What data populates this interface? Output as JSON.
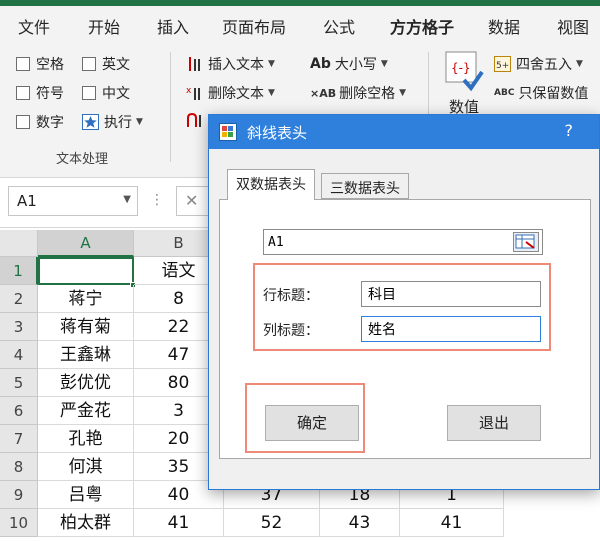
{
  "ribbon_tabs": [
    "文件",
    "开始",
    "插入",
    "页面布局",
    "公式",
    "方方格子",
    "数据",
    "视图"
  ],
  "ribbon": {
    "checkboxes": [
      "空格",
      "英文",
      "符号",
      "中文",
      "数字"
    ],
    "execute_label": "执行",
    "text_ops": [
      "插入文本",
      "删除文本"
    ],
    "case_label": "大小写",
    "case_icon_text": "Ab",
    "remove_space_label": "删除空格",
    "remove_space_icon_text": "×AB",
    "group_label": "文本处理",
    "value_label": "数值",
    "round_label": "四舍五入",
    "keep_value_label": "只保留数值",
    "keep_value_icon_text": "ABC"
  },
  "formula_bar": {
    "name_box": "A1",
    "dots": "⋮",
    "cancel": "✕"
  },
  "sheet": {
    "columns": [
      "A",
      "B"
    ],
    "selected_column": "A",
    "rows": [
      {
        "row": "1",
        "a": "",
        "b": "语文"
      },
      {
        "row": "2",
        "a": "蒋宁",
        "b": "8"
      },
      {
        "row": "3",
        "a": "蒋有菊",
        "b": "22"
      },
      {
        "row": "4",
        "a": "王鑫琳",
        "b": "47"
      },
      {
        "row": "5",
        "a": "彭优优",
        "b": "80"
      },
      {
        "row": "6",
        "a": "严金花",
        "b": "3"
      },
      {
        "row": "7",
        "a": "孔艳",
        "b": "20"
      },
      {
        "row": "8",
        "a": "何淇",
        "b": "35"
      },
      {
        "row": "9",
        "a": "吕粤",
        "b": "40"
      },
      {
        "row": "10",
        "a": "柏太群",
        "b": "41"
      }
    ],
    "visible_right_row9": [
      "37",
      "18",
      "1"
    ],
    "visible_right_row10": [
      "52",
      "43",
      "41"
    ]
  },
  "dialog": {
    "title": "斜线表头",
    "help": "?",
    "tabs": [
      "双数据表头",
      "三数据表头"
    ],
    "active_tab": 0,
    "reference": "A1",
    "row_title_label": "行标题：",
    "row_title_value": "科目",
    "col_title_label": "列标题：",
    "col_title_value": "姓名",
    "ok_label": "确定",
    "exit_label": "退出"
  },
  "colors": {
    "accent": "#217346",
    "dialog_title": "#2f80dc",
    "highlight": "#f08a78"
  }
}
